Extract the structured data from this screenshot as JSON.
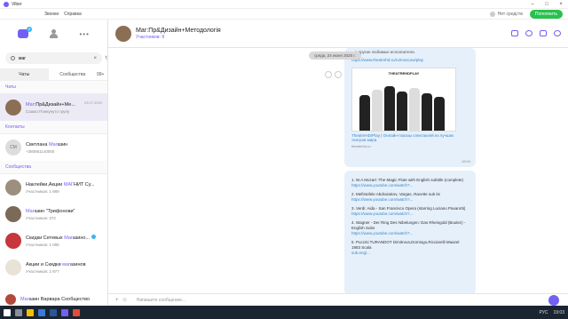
{
  "window": {
    "title": "Viber"
  },
  "menu": {
    "items": [
      "Звонки",
      "Справка"
    ],
    "status": "Нет средств",
    "call_button": "Пополнить"
  },
  "sidebar": {
    "badge": "6",
    "search": {
      "value": "маг",
      "placeholder": "Поиск..."
    },
    "tabs": [
      "Чаты",
      "Сообщества",
      "99+"
    ],
    "sections": {
      "chats": "Чаты",
      "contacts": "Контакты",
      "communities": "Сообщества"
    },
    "chats": [
      {
        "pre": "Маг",
        "name": ":Пр&Дизайн+Ме...",
        "sub": "Сашко Понкунуто групу",
        "time": "03.07.2020"
      }
    ],
    "contacts": [
      {
        "initials": "СМ",
        "pre": "Светлана ",
        "hl": "Маг",
        "post": "азин",
        "sub": "+380661140000"
      }
    ],
    "communities": [
      {
        "pre": "Наклейки,Акции ",
        "hl": "МАГ",
        "post": "НИТ Су...",
        "sub": "Участников: 1 989"
      },
      {
        "pre": "",
        "hl": "Маг",
        "post": "азин \"Трифонови\"",
        "sub": "Участников: 372"
      },
      {
        "pre": "Скидки Сетевых ",
        "hl": "Маг",
        "post": "азино...",
        "sub": "Участников: 1 095"
      },
      {
        "pre": "Акции и Скидки ",
        "hl": "маг",
        "post": "азинов",
        "sub": "Участников: 2 977"
      }
    ],
    "bottom": {
      "hl": "Маг",
      "post": "азин Варвара Сообщество"
    }
  },
  "header": {
    "title": "Маг:Пр&Дизайн+Методологія",
    "sub_label": "Участников: ",
    "sub_count": "8"
  },
  "chat": {
    "date": "среда, 24 июня 2020 г.",
    "msg1": {
      "text": "...и другие любимые исполнители.",
      "link": "https://www.theatrehd.ru/ru/moscow/play",
      "poster_title": "THEATREHDPLAY",
      "caption": "TheatreHD/Play | Онлайн-показы спектаклей из лучших театров мира",
      "domain": "theatrehd.ru",
      "time": "19:04"
    },
    "msg2": {
      "items": [
        {
          "t": "1. W.A Mozart :The Magic Flute with English subtitle (complete)",
          "l": "https://www.youtube.com/watch?..."
        },
        {
          "t": "2. Mefistofele Abdrazakov, Vargas, Racette sub its",
          "l": "https://www.youtube.com/watch?..."
        },
        {
          "t": "3. Verdi: Aida - San Francisco Opera (starring Luciano Pavarotti)",
          "l": "https://www.youtube.com/watch?..."
        },
        {
          "t": "4. Wagner - Der Ring Des Nibelungen: Das Rheingold (Boulez) - English Subs",
          "l": "https://www.youtube.com/watch?..."
        },
        {
          "t": "5. Puccini TURANDOT Dimitrova,Domingo,Ricciarelli Maazel 1983 Scala",
          "l": "sub.engl..."
        }
      ]
    }
  },
  "composer": {
    "placeholder": "Напишите сообщение..."
  },
  "taskbar": {
    "lang": "РУС",
    "time": "19:03"
  },
  "colors": {
    "accent": "#7360f2",
    "call": "#29c14e",
    "bubble": "#e6f0fb",
    "taskbar": "#1b2532"
  }
}
